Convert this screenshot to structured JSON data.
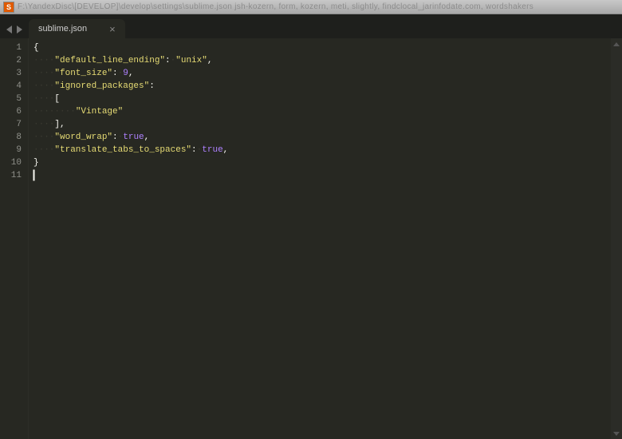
{
  "titlebar": {
    "path_blur": "F:\\YandexDisc\\[DEVELOP]\\develop\\settings\\sublime.json  jsh-kozern,  form,  kozern,  meti,  slightly,  findclocal_jarinfodate.com,  wordshakers"
  },
  "tab": {
    "filename": "sublime.json",
    "close_glyph": "×"
  },
  "gutter": {
    "lines": [
      "1",
      "2",
      "3",
      "4",
      "5",
      "6",
      "7",
      "8",
      "9",
      "10",
      "11"
    ]
  },
  "code": {
    "ws4": "····",
    "ws8": "········",
    "brace_open": "{",
    "brace_close": "}",
    "bracket_open": "[",
    "bracket_close": "]",
    "comma": ",",
    "colon": ":",
    "mid_dot": "·",
    "k_default_line_ending": "\"default_line_ending\"",
    "v_unix": "\"unix\"",
    "k_font_size": "\"font_size\"",
    "v_9": "9",
    "k_ignored_packages": "\"ignored_packages\"",
    "v_vintage": "\"Vintage\"",
    "k_word_wrap": "\"word_wrap\"",
    "k_translate_tabs": "\"translate_tabs_to_spaces\"",
    "v_true": "true"
  }
}
